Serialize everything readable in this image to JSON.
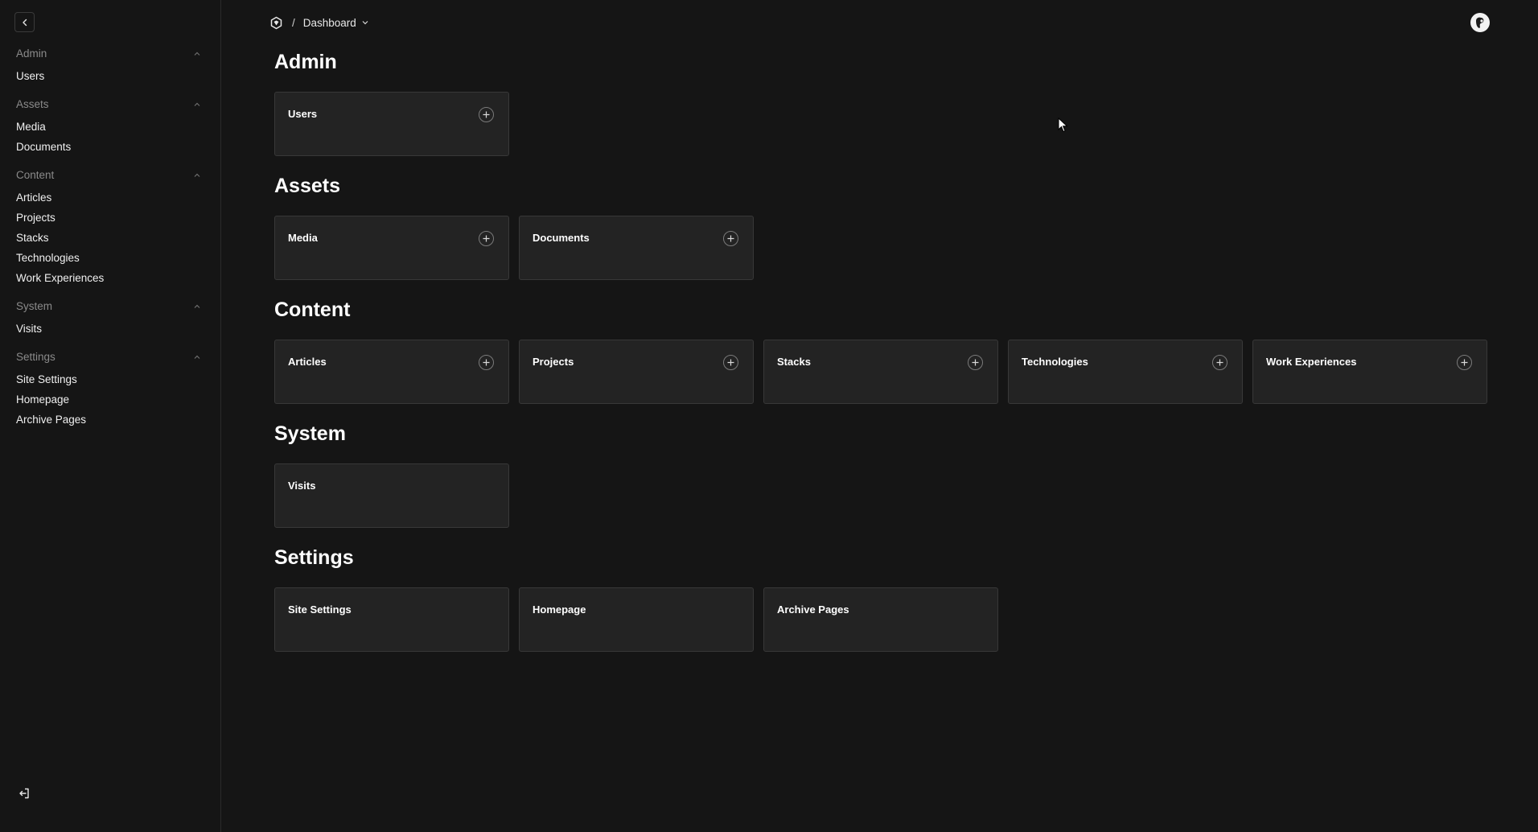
{
  "breadcrumb": {
    "separator": "/",
    "current": "Dashboard"
  },
  "sidebar": {
    "groups": [
      {
        "label": "Admin",
        "items": [
          {
            "label": "Users"
          }
        ]
      },
      {
        "label": "Assets",
        "items": [
          {
            "label": "Media"
          },
          {
            "label": "Documents"
          }
        ]
      },
      {
        "label": "Content",
        "items": [
          {
            "label": "Articles"
          },
          {
            "label": "Projects"
          },
          {
            "label": "Stacks"
          },
          {
            "label": "Technologies"
          },
          {
            "label": "Work Experiences"
          }
        ]
      },
      {
        "label": "System",
        "items": [
          {
            "label": "Visits"
          }
        ]
      },
      {
        "label": "Settings",
        "items": [
          {
            "label": "Site Settings"
          },
          {
            "label": "Homepage"
          },
          {
            "label": "Archive Pages"
          }
        ]
      }
    ]
  },
  "sections": [
    {
      "title": "Admin",
      "cards": [
        {
          "label": "Users",
          "addable": true
        }
      ]
    },
    {
      "title": "Assets",
      "cards": [
        {
          "label": "Media",
          "addable": true
        },
        {
          "label": "Documents",
          "addable": true
        }
      ]
    },
    {
      "title": "Content",
      "cards": [
        {
          "label": "Articles",
          "addable": true
        },
        {
          "label": "Projects",
          "addable": true
        },
        {
          "label": "Stacks",
          "addable": true
        },
        {
          "label": "Technologies",
          "addable": true
        },
        {
          "label": "Work Experiences",
          "addable": true
        }
      ]
    },
    {
      "title": "System",
      "cards": [
        {
          "label": "Visits",
          "addable": false
        }
      ]
    },
    {
      "title": "Settings",
      "cards": [
        {
          "label": "Site Settings",
          "addable": false
        },
        {
          "label": "Homepage",
          "addable": false
        },
        {
          "label": "Archive Pages",
          "addable": false
        }
      ]
    }
  ],
  "icons": {
    "collapse": "chevron-left-icon",
    "group_toggle": "chevron-up-icon",
    "logout": "logout-icon",
    "home": "logo-icon",
    "dropdown": "chevron-down-icon",
    "add": "plus-icon",
    "avatar": "avatar"
  },
  "colors": {
    "background": "#151515",
    "card_background": "#232323",
    "card_border": "#383838",
    "muted_text": "#8a8a8a",
    "text": "#ffffff"
  }
}
